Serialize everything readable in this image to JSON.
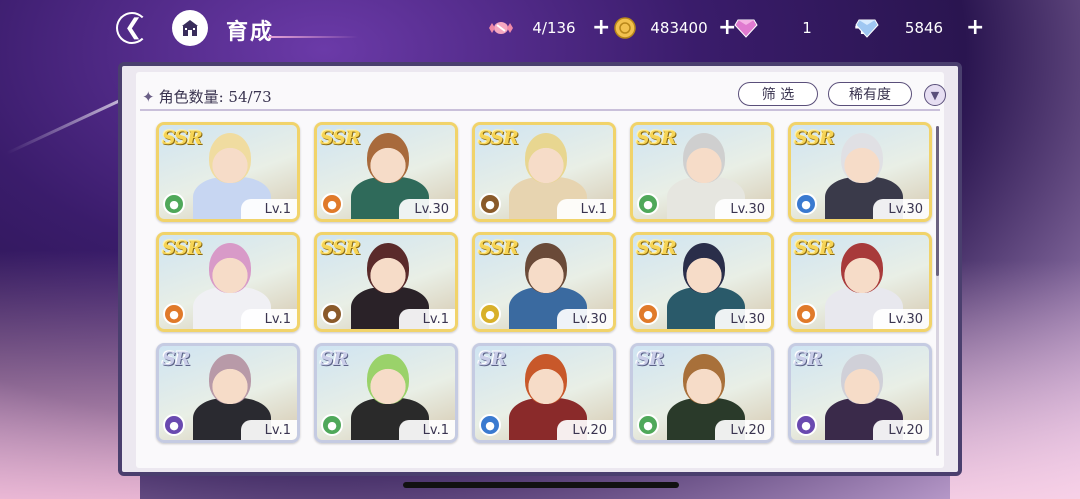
{
  "header": {
    "title": "育成",
    "resources": [
      {
        "name": "candy",
        "icon": "candy-icon",
        "value": "4/136",
        "color": "#f08aa8"
      },
      {
        "name": "coin",
        "icon": "coin-icon",
        "value": "483400",
        "color": "#f2c14e"
      },
      {
        "name": "pink-gem",
        "icon": "pink-gem-icon",
        "value": "1",
        "color": "#e07ad0"
      },
      {
        "name": "blue-gem",
        "icon": "blue-gem-icon",
        "value": "5846",
        "color": "#9fc7f2"
      }
    ]
  },
  "panel": {
    "count_label": "角色数量:",
    "count_value": "54/73",
    "filter_label": "筛 选",
    "sort_label": "稀有度"
  },
  "cards": [
    {
      "rarity": "SSR",
      "level": "Lv.1",
      "element": "green",
      "hair": "#f0dca0",
      "outfit": "#c7d6f2"
    },
    {
      "rarity": "SSR",
      "level": "Lv.30",
      "element": "orange",
      "hair": "#a86a3c",
      "outfit": "#2f6a5a"
    },
    {
      "rarity": "SSR",
      "level": "Lv.1",
      "element": "brown",
      "hair": "#e8d690",
      "outfit": "#e7d4b0"
    },
    {
      "rarity": "SSR",
      "level": "Lv.30",
      "element": "green",
      "hair": "#cfcfcf",
      "outfit": "#e6e6e0"
    },
    {
      "rarity": "SSR",
      "level": "Lv.30",
      "element": "blue",
      "hair": "#e0e0e4",
      "outfit": "#3a3a4a"
    },
    {
      "rarity": "SSR",
      "level": "Lv.1",
      "element": "orange",
      "hair": "#d89ac8",
      "outfit": "#f0f0f4"
    },
    {
      "rarity": "SSR",
      "level": "Lv.1",
      "element": "brown",
      "hair": "#5a2a2a",
      "outfit": "#2a2228"
    },
    {
      "rarity": "SSR",
      "level": "Lv.30",
      "element": "yellow",
      "hair": "#6a4a38",
      "outfit": "#3a6aa0"
    },
    {
      "rarity": "SSR",
      "level": "Lv.30",
      "element": "orange",
      "hair": "#2a2e4a",
      "outfit": "#2a5a6a"
    },
    {
      "rarity": "SSR",
      "level": "Lv.30",
      "element": "orange",
      "hair": "#a83a3a",
      "outfit": "#e8e8ee"
    },
    {
      "rarity": "SR",
      "level": "Lv.1",
      "element": "purple",
      "hair": "#b89aa8",
      "outfit": "#2a2a30"
    },
    {
      "rarity": "SR",
      "level": "Lv.1",
      "element": "green",
      "hair": "#9ad26a",
      "outfit": "#2a2a2a"
    },
    {
      "rarity": "SR",
      "level": "Lv.20",
      "element": "blue",
      "hair": "#c8582a",
      "outfit": "#8a2a2a"
    },
    {
      "rarity": "SR",
      "level": "Lv.20",
      "element": "green",
      "hair": "#a8703a",
      "outfit": "#2a3a2a"
    },
    {
      "rarity": "SR",
      "level": "Lv.20",
      "element": "purple",
      "hair": "#d0d0d8",
      "outfit": "#3a2a4a"
    }
  ],
  "element_colors": {
    "green": "#4fa85a",
    "orange": "#e07a2a",
    "brown": "#8a5a2a",
    "blue": "#3a7ad0",
    "yellow": "#d8b02a",
    "purple": "#6a4ab0"
  },
  "element_icons": {
    "green": "leaf-icon",
    "orange": "flame-icon",
    "brown": "shield-icon",
    "blue": "water-icon",
    "yellow": "book-icon",
    "purple": "gear-icon"
  }
}
